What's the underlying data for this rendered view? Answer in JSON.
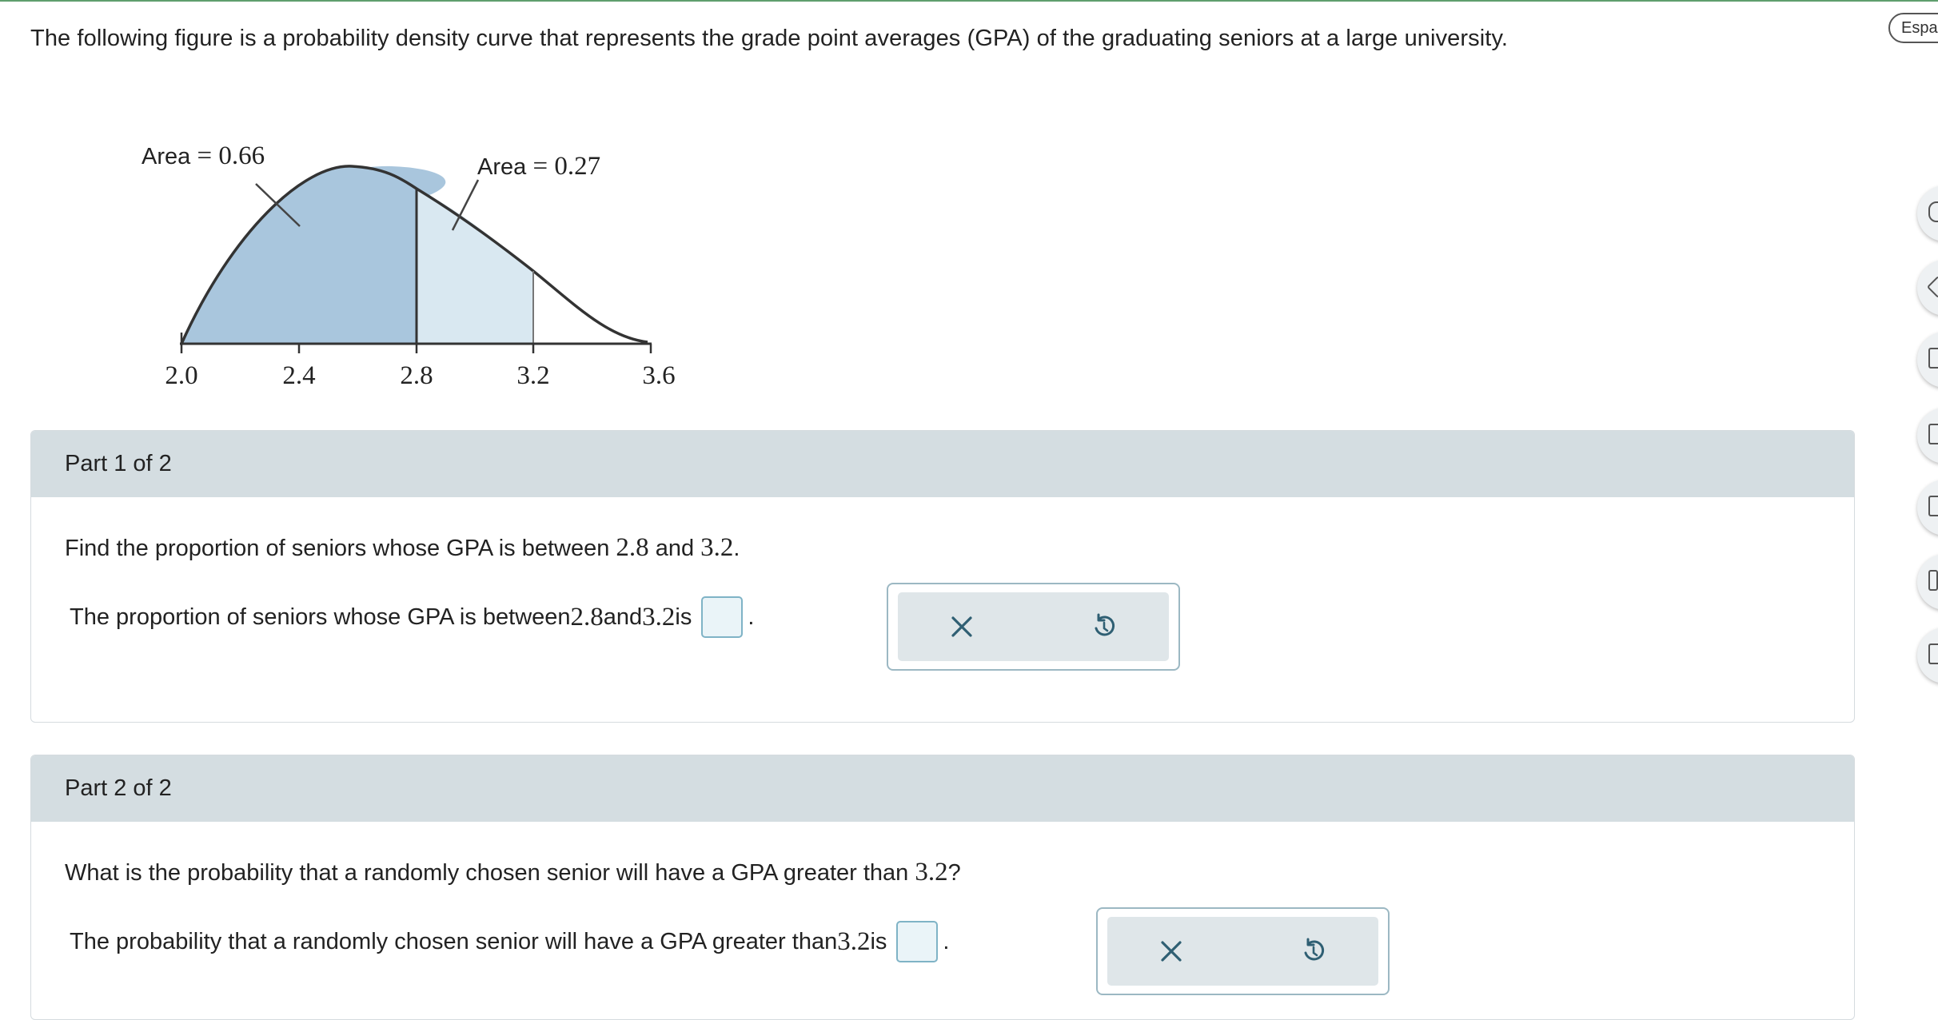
{
  "intro": "The following figure is a probability density curve that represents the grade point averages (GPA) of the graduating seniors at a large university.",
  "figure": {
    "area_left_prefix": "Area",
    "area_left_value": "0.66",
    "area_right_prefix": "Area",
    "area_right_value": "0.27",
    "ticks": [
      "2.0",
      "2.4",
      "2.8",
      "3.2",
      "3.6"
    ]
  },
  "part1": {
    "header": "Part 1 of 2",
    "question_a": "Find the proportion of seniors whose GPA is between ",
    "q_num1": "2.8",
    "question_b": " and ",
    "q_num2": "3.2",
    "question_c": ".",
    "answer_a": "The proportion of seniors whose GPA is between ",
    "a_num1": "2.8",
    "answer_b": " and ",
    "a_num2": "3.2",
    "answer_c": " is",
    "answer_value": "",
    "period": "."
  },
  "part2": {
    "header": "Part 2 of 2",
    "question_a": "What is the probability that a randomly chosen senior will have a GPA greater than ",
    "q_num": "3.2",
    "question_b": "?",
    "answer_a": "The probability that a randomly chosen senior will have a GPA greater than ",
    "a_num": "3.2",
    "answer_b": " is",
    "answer_value": "",
    "period": "."
  },
  "tools": {
    "clear_icon": "x-icon",
    "undo_icon": "undo-icon"
  },
  "rail": {
    "language_label": "Espa"
  },
  "colors": {
    "shade_dark": "#a9c6dd",
    "shade_light": "#d9e8f1",
    "header_bg": "#d4dde1"
  }
}
